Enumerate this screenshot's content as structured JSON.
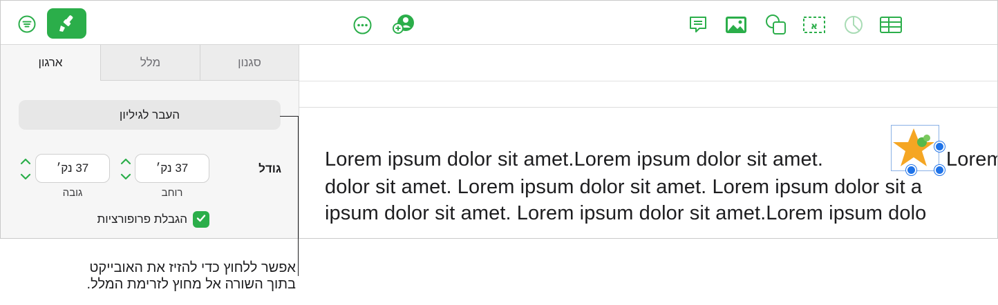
{
  "toolbar": {
    "left_icons": [
      "menu-circle-icon",
      "paintbrush-icon"
    ],
    "center_icons": [
      "more-icon",
      "add-collaborator-icon"
    ],
    "right_icons": [
      "comment-icon",
      "image-icon",
      "shape-icon",
      "text-box-icon",
      "chart-icon",
      "table-icon"
    ],
    "accent": "#2bae4a"
  },
  "sidebar": {
    "tabs": [
      {
        "label": "סגנון",
        "active": false
      },
      {
        "label": "מלל",
        "active": false
      },
      {
        "label": "ארגון",
        "active": true
      }
    ],
    "move_button": "העבר לגיליון",
    "size_label": "גודל",
    "width": {
      "value": "37 נק׳",
      "caption": "רוחב"
    },
    "height": {
      "value": "37 נק׳",
      "caption": "גובה"
    },
    "constrain": {
      "label": "הגבלת פרופורציות",
      "checked": true
    }
  },
  "document": {
    "lines": [
      "Lorem ipsum dolor sit amet.Lorem ipsum dolor sit amet.",
      "dolor sit amet. Lorem ipsum dolor sit amet. Lorem ipsum dolor sit a",
      "ipsum dolor sit amet. Lorem ipsum dolor sit amet.Lorem ipsum dolo"
    ],
    "line1_tail": "Lorem",
    "selection_color": "#1f73e8",
    "star_color": "#f5a623"
  },
  "callout": {
    "lines": [
      "אפשר ללחוץ כדי להזיז את האובייקט",
      "בתוך השורה אל מחוץ לזרימת המלל."
    ]
  }
}
